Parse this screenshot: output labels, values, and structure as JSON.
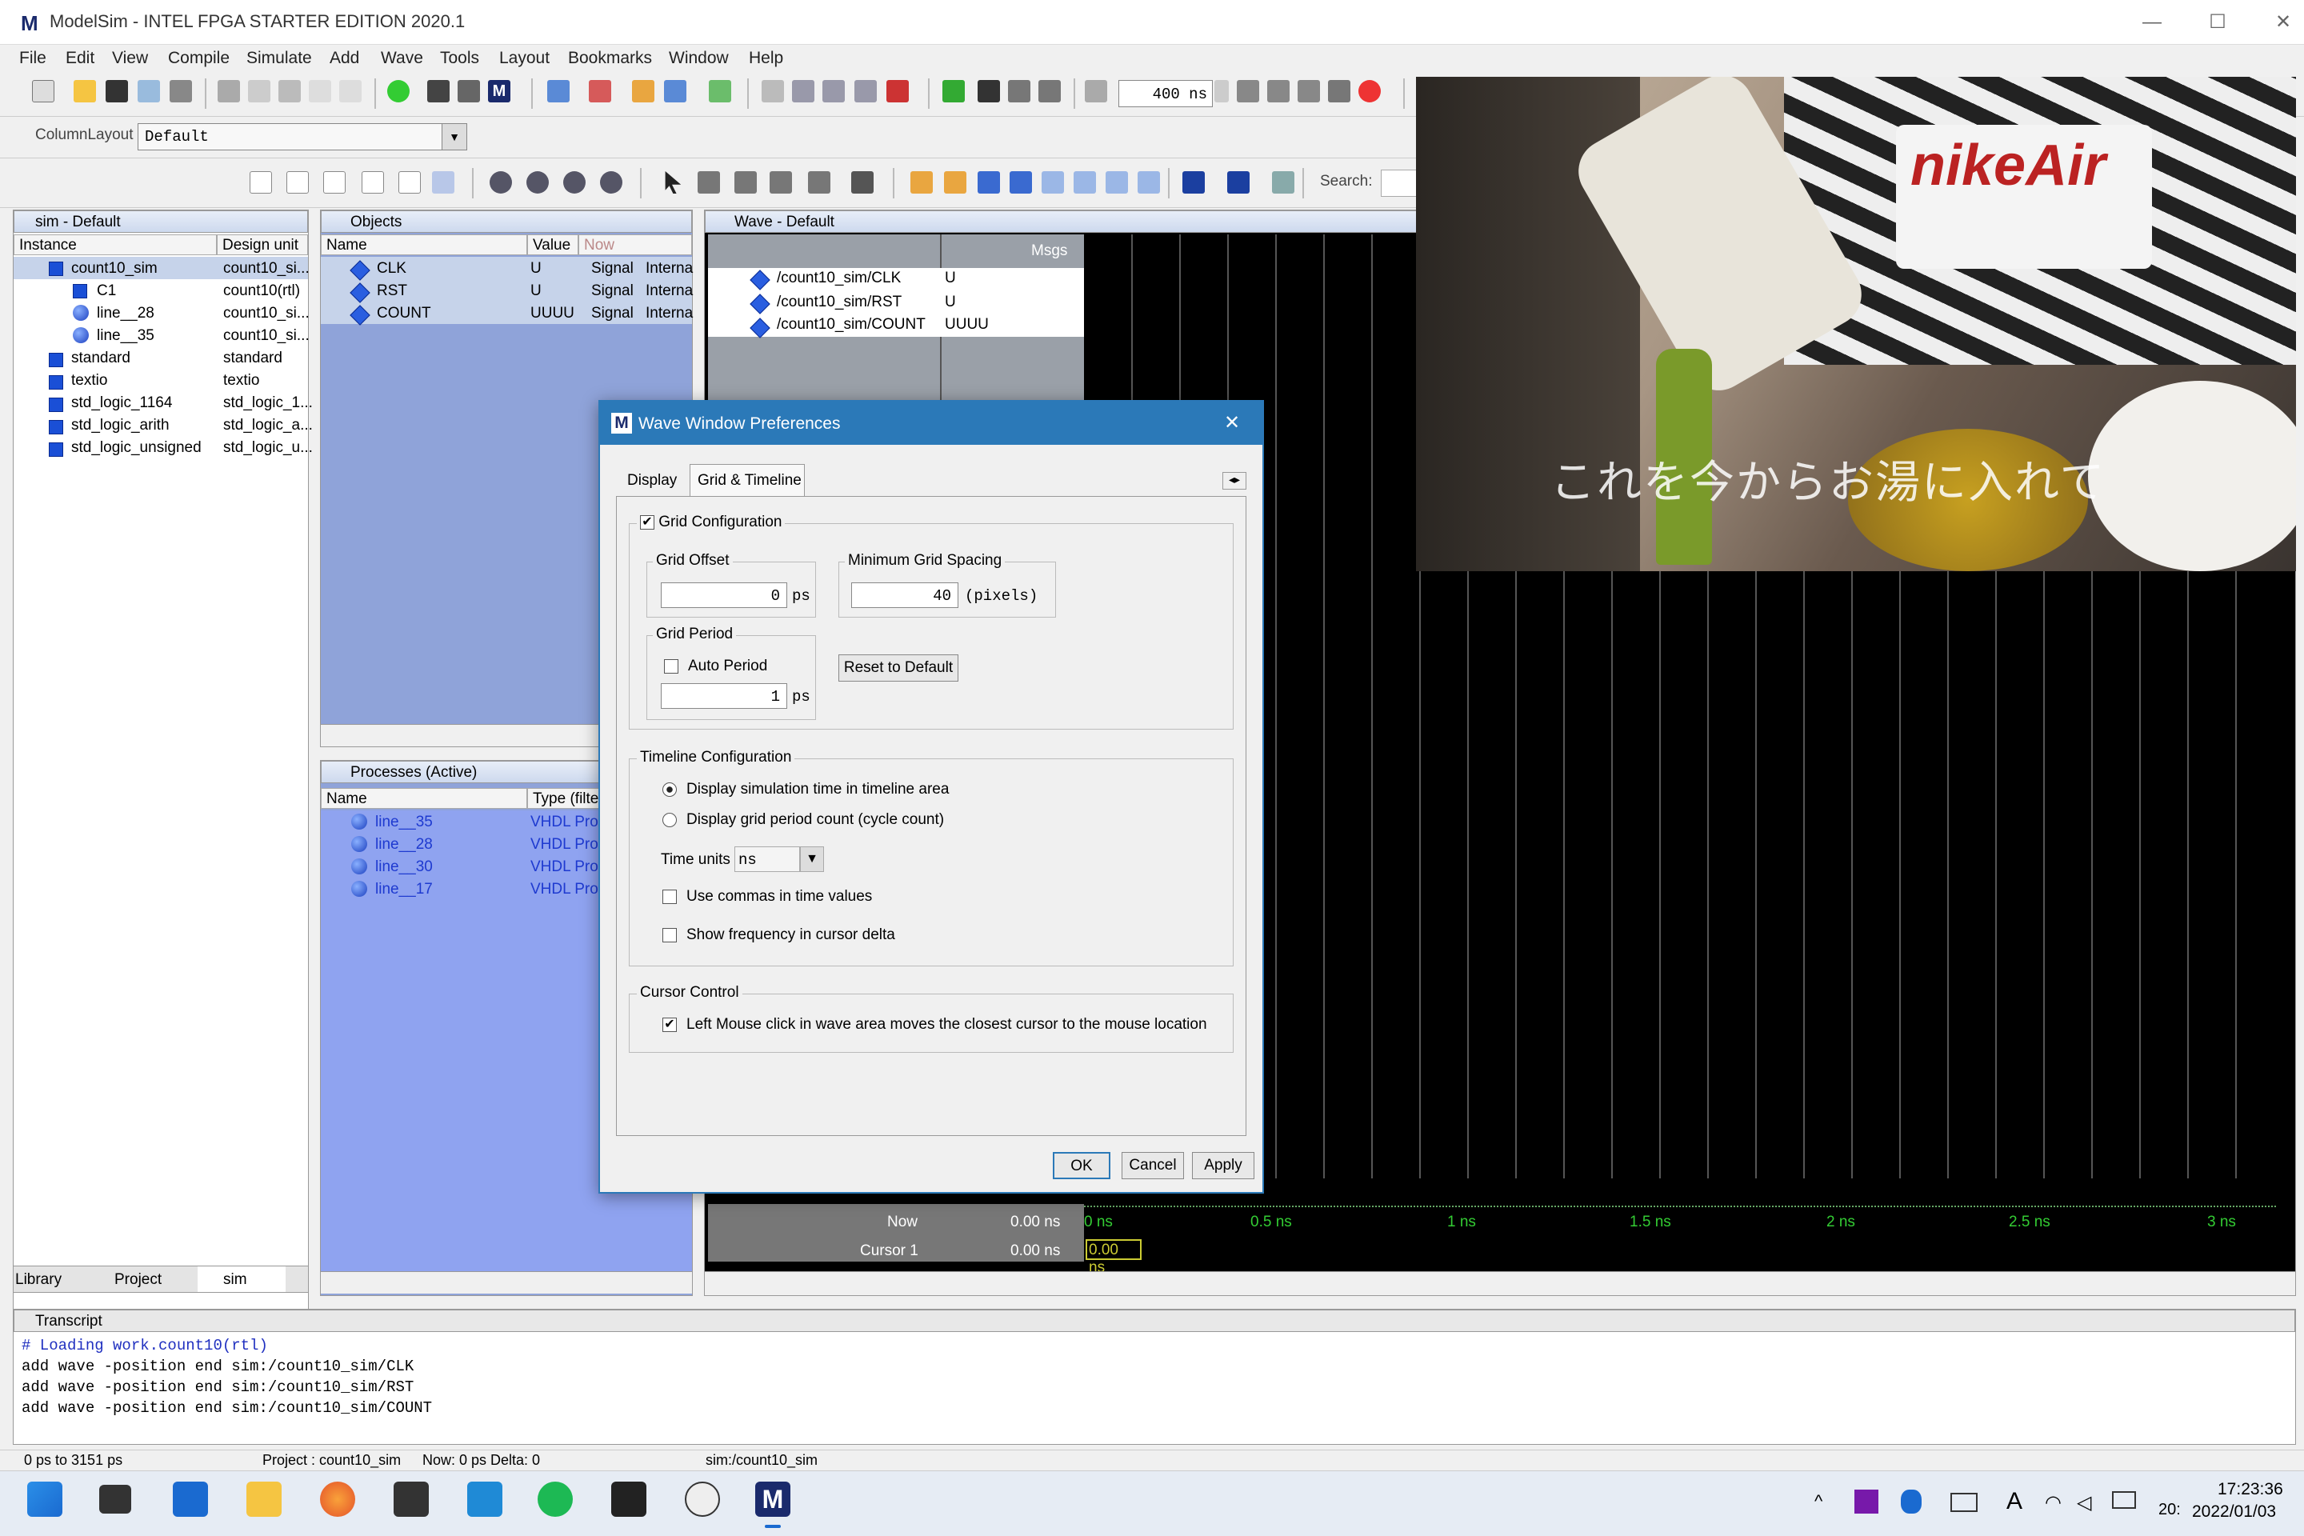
{
  "app": {
    "title": "ModelSim - INTEL FPGA STARTER EDITION 2020.1",
    "logo": "M"
  },
  "menu": [
    "File",
    "Edit",
    "View",
    "Compile",
    "Simulate",
    "Add",
    "Wave",
    "Tools",
    "Layout",
    "Bookmarks",
    "Window",
    "Help"
  ],
  "toolbar": {
    "runtime_value": "400 ns",
    "column_layout_label": "ColumnLayout",
    "column_layout_value": "Default",
    "search_label": "Search:"
  },
  "sim_panel": {
    "title": "sim - Default",
    "columns": [
      "Instance",
      "Design unit"
    ],
    "rows": [
      {
        "name": "count10_sim",
        "unit": "count10_si..."
      },
      {
        "name": "C1",
        "unit": "count10(rtl)"
      },
      {
        "name": "line__28",
        "unit": "count10_si..."
      },
      {
        "name": "line__35",
        "unit": "count10_si..."
      },
      {
        "name": "standard",
        "unit": "standard"
      },
      {
        "name": "textio",
        "unit": "textio"
      },
      {
        "name": "std_logic_1164",
        "unit": "std_logic_1..."
      },
      {
        "name": "std_logic_arith",
        "unit": "std_logic_a..."
      },
      {
        "name": "std_logic_unsigned",
        "unit": "std_logic_u..."
      }
    ],
    "tabs": [
      "Library",
      "Project",
      "sim"
    ]
  },
  "objects_panel": {
    "title": "Objects",
    "columns": [
      "Name",
      "Value",
      "Now"
    ],
    "rows": [
      {
        "name": "CLK",
        "value": "U",
        "kind": "Signal",
        "mode": "Interna"
      },
      {
        "name": "RST",
        "value": "U",
        "kind": "Signal",
        "mode": "Interna"
      },
      {
        "name": "COUNT",
        "value": "UUUU",
        "kind": "Signal",
        "mode": "Interna"
      }
    ]
  },
  "processes_panel": {
    "title": "Processes (Active)",
    "columns": [
      "Name",
      "Type (filte"
    ],
    "rows": [
      {
        "name": "line__35",
        "type": "VHDL Proc"
      },
      {
        "name": "line__28",
        "type": "VHDL Proc"
      },
      {
        "name": "line__30",
        "type": "VHDL Proc"
      },
      {
        "name": "line__17",
        "type": "VHDL Proc"
      }
    ]
  },
  "wave_panel": {
    "title": "Wave - Default",
    "msgs_label": "Msgs",
    "signals": [
      {
        "path": "/count10_sim/CLK",
        "value": "U"
      },
      {
        "path": "/count10_sim/RST",
        "value": "U"
      },
      {
        "path": "/count10_sim/COUNT",
        "value": "UUUU"
      }
    ],
    "now_label": "Now",
    "now_value": "0.00 ns",
    "cursor_label": "Cursor 1",
    "cursor_value": "0.00 ns",
    "cursor_marker": "0.00 ns",
    "timeline_ticks": [
      "0 ns",
      "0.5 ns",
      "1 ns",
      "1.5 ns",
      "2 ns",
      "2.5 ns",
      "3 ns"
    ]
  },
  "dialog": {
    "title": "Wave Window Preferences",
    "tabs": [
      "Display",
      "Grid & Timeline"
    ],
    "grid_config_label": "Grid Configuration",
    "grid_offset_label": "Grid Offset",
    "grid_offset_value": "0",
    "grid_offset_unit": "ps",
    "min_spacing_label": "Minimum Grid Spacing",
    "min_spacing_value": "40",
    "min_spacing_unit": "(pixels)",
    "grid_period_label": "Grid Period",
    "auto_period_label": "Auto Period",
    "grid_period_value": "1",
    "grid_period_unit": "ps",
    "reset_label": "Reset to Default",
    "timeline_label": "Timeline Configuration",
    "radio_sim_time": "Display simulation time in timeline area",
    "radio_grid_count": "Display grid period count (cycle count)",
    "time_units_label": "Time units",
    "time_units_value": "ns",
    "commas_label": "Use commas in time values",
    "freq_label": "Show frequency in cursor delta",
    "cursor_control_label": "Cursor Control",
    "cursor_click_label": "Left Mouse click in wave area moves the closest cursor to the mouse location",
    "ok": "OK",
    "cancel": "Cancel",
    "apply": "Apply"
  },
  "video": {
    "caption": "これを今からお湯に入れて",
    "shirt_text": "nikeAir"
  },
  "transcript": {
    "title": "Transcript",
    "lines": [
      "# Loading work.count10(rtl)",
      "add wave -position end  sim:/count10_sim/CLK",
      "add wave -position end  sim:/count10_sim/RST",
      "add wave -position end  sim:/count10_sim/COUNT"
    ]
  },
  "statusbar": {
    "range": "0 ps to 3151 ps",
    "project": "Project : count10_sim",
    "now": "Now: 0 ps  Delta: 0",
    "context": "sim:/count10_sim"
  },
  "taskbar": {
    "time": "17:23:36",
    "date": "2022/01/03",
    "clipped": "20:",
    "lang": "A"
  }
}
